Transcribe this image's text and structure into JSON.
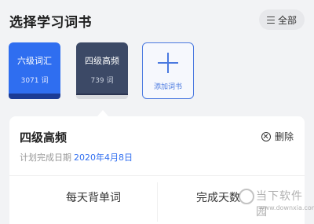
{
  "header": {
    "title": "选择学习词书",
    "all_button_label": "全部",
    "all_button_icon": "menu-icon"
  },
  "books": [
    {
      "title": "六级词汇",
      "count": "3071 词",
      "color": "#2f6ef0",
      "selected": false
    },
    {
      "title": "四级高频",
      "count": "739 词",
      "color": "#3c4966",
      "selected": true
    }
  ],
  "add_book": {
    "label": "添加词书",
    "icon": "plus-icon"
  },
  "detail": {
    "title": "四级高频",
    "delete_label": "删除",
    "delete_icon": "x-circle-icon",
    "plan_label": "计划完成日期",
    "plan_date": "2020年4月8日",
    "daily_words_label": "每天背单词",
    "days_label": "完成天数",
    "daily_words_value": "",
    "days_value": ""
  },
  "watermark": {
    "text": "当下软件园",
    "url": "www.downxia.com"
  },
  "colors": {
    "accent": "#2f6ef0",
    "background": "#f2f3f5"
  }
}
